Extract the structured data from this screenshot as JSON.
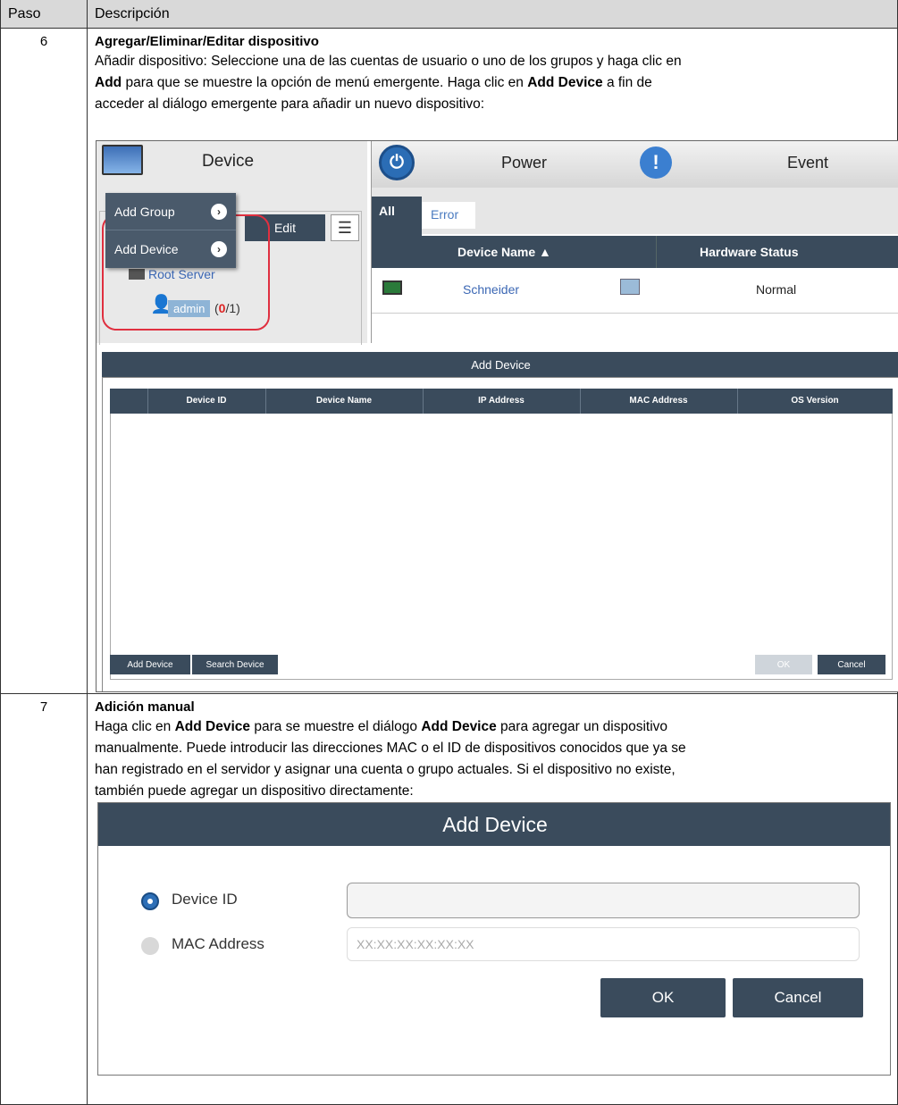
{
  "table": {
    "col_step": "Paso",
    "col_desc": "Descripción"
  },
  "step6": {
    "number": "6",
    "title": "Agregar/Eliminar/Editar dispositivo",
    "line1": "Añadir dispositivo: Seleccione una de las cuentas de usuario o uno de los grupos y haga clic en",
    "line2_bold1": "Add",
    "line2_rest": " para que se muestre la opción de menú emergente. Haga clic en ",
    "line2_bold2": "Add Device",
    "line2_end": " a fin de",
    "line3": "acceder al diálogo emergente para añadir un nuevo dispositivo:"
  },
  "shot1": {
    "device_tab": "Device",
    "power_tab": "Power",
    "event_tab": "Event",
    "edit_label": "Edit",
    "popup": [
      "Add Group",
      "Add Device"
    ],
    "root_server": "Root Server",
    "admin": "admin",
    "admin_count_open": " (",
    "admin_count_red": "0",
    "admin_count_close": "/1)",
    "tab_all": "All",
    "tab_error": "Error",
    "col_device_name": "Device Name ▲",
    "col_hw_status": "Hardware Status",
    "row_name": "Schneider",
    "row_status": "Normal",
    "dialog_title": "Add Device",
    "grid_columns": [
      "Device ID",
      "Device Name",
      "IP Address",
      "MAC Address",
      "OS Version"
    ],
    "btn_add_device": "Add Device",
    "btn_search_device": "Search Device",
    "btn_ok": "OK",
    "btn_cancel": "Cancel",
    "colors": {
      "dark": "#3a4b5c",
      "link": "#3b67b4",
      "highlight": "#e03040"
    }
  },
  "step7": {
    "number": "7",
    "title": "Adición manual",
    "line1_a": "Haga clic en ",
    "line1_b": "Add Device",
    "line1_c": " para se muestre el diálogo ",
    "line1_d": "Add Device",
    "line1_e": " para agregar un dispositivo",
    "line2": "manualmente. Puede introducir las direcciones MAC o el ID de dispositivos conocidos que ya se",
    "line3": "han registrado en el servidor y asignar una cuenta o grupo actuales. Si el dispositivo no existe,",
    "line4": "también puede agregar un dispositivo directamente:"
  },
  "shot2": {
    "title": "Add Device",
    "device_id_label": "Device ID",
    "mac_label": "MAC Address",
    "mac_placeholder": "XX:XX:XX:XX:XX:XX",
    "ok": "OK",
    "cancel": "Cancel"
  }
}
